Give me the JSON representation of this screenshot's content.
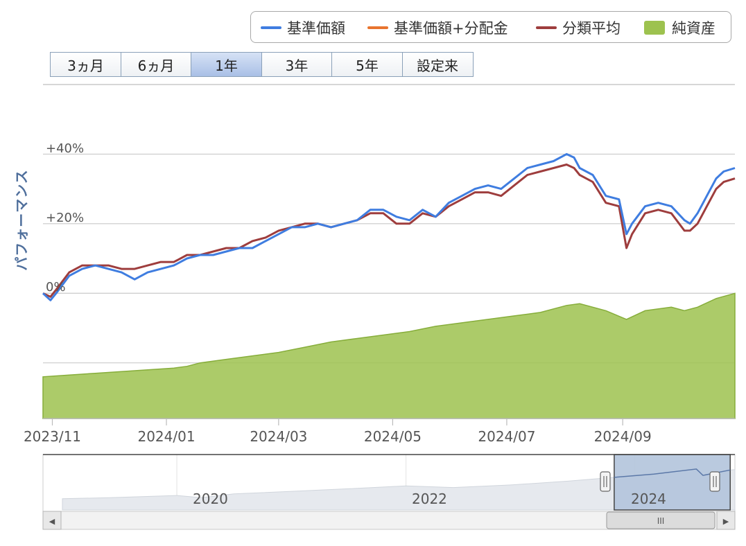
{
  "legend": {
    "items": [
      {
        "label": "基準価額",
        "color": "#3f7de0",
        "kind": "line"
      },
      {
        "label": "基準価額+分配金",
        "color": "#e8742e",
        "kind": "line"
      },
      {
        "label": "分類平均",
        "color": "#9e3d3d",
        "kind": "line"
      },
      {
        "label": "純資産",
        "color": "#9dc24f",
        "kind": "area"
      }
    ]
  },
  "range_buttons": [
    {
      "label": "3ヵ月",
      "selected": false
    },
    {
      "label": "6ヵ月",
      "selected": false
    },
    {
      "label": "1年",
      "selected": true
    },
    {
      "label": "3年",
      "selected": false
    },
    {
      "label": "5年",
      "selected": false
    },
    {
      "label": "設定来",
      "selected": false
    }
  ],
  "navigator": {
    "year_labels": [
      "2020",
      "2022",
      "2024"
    ],
    "scroll_grip": "III",
    "left_arrow": "◀",
    "right_arrow": "▶"
  },
  "chart_data": {
    "type": "line",
    "ylabel": "パフォーマンス",
    "y_ticks": [
      "+40%",
      "+20%",
      "0%"
    ],
    "ylim": [
      -36,
      60
    ],
    "x_ticks": [
      "2023/11",
      "2024/01",
      "2024/03",
      "2024/05",
      "2024/07",
      "2024/09"
    ],
    "x_range": [
      "2023-10-27",
      "2024-10-31"
    ],
    "grid": true,
    "legend_position": "top-right",
    "series": [
      {
        "name": "基準価額",
        "color": "#3f7de0",
        "points": [
          [
            "2023-10-27",
            0
          ],
          [
            "2023-10-31",
            -2
          ],
          [
            "2023-11-03",
            0
          ],
          [
            "2023-11-10",
            5
          ],
          [
            "2023-11-17",
            7
          ],
          [
            "2023-11-24",
            8
          ],
          [
            "2023-12-01",
            7
          ],
          [
            "2023-12-08",
            6
          ],
          [
            "2023-12-15",
            4
          ],
          [
            "2023-12-22",
            6
          ],
          [
            "2023-12-29",
            7
          ],
          [
            "2024-01-05",
            8
          ],
          [
            "2024-01-12",
            10
          ],
          [
            "2024-01-19",
            11
          ],
          [
            "2024-01-26",
            11
          ],
          [
            "2024-02-02",
            12
          ],
          [
            "2024-02-09",
            13
          ],
          [
            "2024-02-16",
            13
          ],
          [
            "2024-02-23",
            15
          ],
          [
            "2024-03-01",
            17
          ],
          [
            "2024-03-08",
            19
          ],
          [
            "2024-03-15",
            19
          ],
          [
            "2024-03-22",
            20
          ],
          [
            "2024-03-29",
            19
          ],
          [
            "2024-04-05",
            20
          ],
          [
            "2024-04-12",
            21
          ],
          [
            "2024-04-19",
            24
          ],
          [
            "2024-04-26",
            24
          ],
          [
            "2024-05-03",
            22
          ],
          [
            "2024-05-10",
            21
          ],
          [
            "2024-05-17",
            24
          ],
          [
            "2024-05-24",
            22
          ],
          [
            "2024-05-31",
            26
          ],
          [
            "2024-06-07",
            28
          ],
          [
            "2024-06-14",
            30
          ],
          [
            "2024-06-21",
            31
          ],
          [
            "2024-06-28",
            30
          ],
          [
            "2024-07-05",
            33
          ],
          [
            "2024-07-12",
            36
          ],
          [
            "2024-07-19",
            37
          ],
          [
            "2024-07-26",
            38
          ],
          [
            "2024-08-02",
            40
          ],
          [
            "2024-08-06",
            39
          ],
          [
            "2024-08-09",
            36
          ],
          [
            "2024-08-16",
            34
          ],
          [
            "2024-08-23",
            28
          ],
          [
            "2024-08-30",
            27
          ],
          [
            "2024-09-03",
            17
          ],
          [
            "2024-09-06",
            20
          ],
          [
            "2024-09-13",
            25
          ],
          [
            "2024-09-20",
            26
          ],
          [
            "2024-09-27",
            25
          ],
          [
            "2024-10-04",
            21
          ],
          [
            "2024-10-07",
            20
          ],
          [
            "2024-10-11",
            23
          ],
          [
            "2024-10-16",
            28
          ],
          [
            "2024-10-21",
            33
          ],
          [
            "2024-10-25",
            35
          ],
          [
            "2024-10-31",
            36
          ]
        ]
      },
      {
        "name": "分類平均",
        "color": "#9e3d3d",
        "points": [
          [
            "2023-10-27",
            0
          ],
          [
            "2023-10-31",
            -1
          ],
          [
            "2023-11-03",
            1
          ],
          [
            "2023-11-10",
            6
          ],
          [
            "2023-11-17",
            8
          ],
          [
            "2023-11-24",
            8
          ],
          [
            "2023-12-01",
            8
          ],
          [
            "2023-12-08",
            7
          ],
          [
            "2023-12-15",
            7
          ],
          [
            "2023-12-22",
            8
          ],
          [
            "2023-12-29",
            9
          ],
          [
            "2024-01-05",
            9
          ],
          [
            "2024-01-12",
            11
          ],
          [
            "2024-01-19",
            11
          ],
          [
            "2024-01-26",
            12
          ],
          [
            "2024-02-02",
            13
          ],
          [
            "2024-02-09",
            13
          ],
          [
            "2024-02-16",
            15
          ],
          [
            "2024-02-23",
            16
          ],
          [
            "2024-03-01",
            18
          ],
          [
            "2024-03-08",
            19
          ],
          [
            "2024-03-15",
            20
          ],
          [
            "2024-03-22",
            20
          ],
          [
            "2024-03-29",
            19
          ],
          [
            "2024-04-05",
            20
          ],
          [
            "2024-04-12",
            21
          ],
          [
            "2024-04-19",
            23
          ],
          [
            "2024-04-26",
            23
          ],
          [
            "2024-05-03",
            20
          ],
          [
            "2024-05-10",
            20
          ],
          [
            "2024-05-17",
            23
          ],
          [
            "2024-05-24",
            22
          ],
          [
            "2024-05-31",
            25
          ],
          [
            "2024-06-07",
            27
          ],
          [
            "2024-06-14",
            29
          ],
          [
            "2024-06-21",
            29
          ],
          [
            "2024-06-28",
            28
          ],
          [
            "2024-07-05",
            31
          ],
          [
            "2024-07-12",
            34
          ],
          [
            "2024-07-19",
            35
          ],
          [
            "2024-07-26",
            36
          ],
          [
            "2024-08-02",
            37
          ],
          [
            "2024-08-06",
            36
          ],
          [
            "2024-08-09",
            34
          ],
          [
            "2024-08-16",
            32
          ],
          [
            "2024-08-23",
            26
          ],
          [
            "2024-08-30",
            25
          ],
          [
            "2024-09-03",
            13
          ],
          [
            "2024-09-06",
            17
          ],
          [
            "2024-09-13",
            23
          ],
          [
            "2024-09-20",
            24
          ],
          [
            "2024-09-27",
            23
          ],
          [
            "2024-10-04",
            18
          ],
          [
            "2024-10-07",
            18
          ],
          [
            "2024-10-11",
            20
          ],
          [
            "2024-10-16",
            25
          ],
          [
            "2024-10-21",
            30
          ],
          [
            "2024-10-25",
            32
          ],
          [
            "2024-10-31",
            33
          ]
        ]
      },
      {
        "name": "純資産",
        "color": "#9dc24f",
        "kind": "area",
        "points": [
          [
            "2023-10-27",
            -24
          ],
          [
            "2023-11-10",
            -23.5
          ],
          [
            "2023-11-24",
            -23
          ],
          [
            "2023-12-08",
            -22.5
          ],
          [
            "2023-12-22",
            -22
          ],
          [
            "2024-01-05",
            -21.5
          ],
          [
            "2024-01-12",
            -21
          ],
          [
            "2024-01-19",
            -20
          ],
          [
            "2024-02-02",
            -19
          ],
          [
            "2024-02-16",
            -18
          ],
          [
            "2024-03-01",
            -17
          ],
          [
            "2024-03-15",
            -15.5
          ],
          [
            "2024-03-29",
            -14
          ],
          [
            "2024-04-12",
            -13
          ],
          [
            "2024-04-26",
            -12
          ],
          [
            "2024-05-10",
            -11
          ],
          [
            "2024-05-24",
            -9.5
          ],
          [
            "2024-06-07",
            -8.5
          ],
          [
            "2024-06-21",
            -7.5
          ],
          [
            "2024-07-05",
            -6.5
          ],
          [
            "2024-07-19",
            -5.5
          ],
          [
            "2024-08-02",
            -3.5
          ],
          [
            "2024-08-09",
            -3
          ],
          [
            "2024-08-23",
            -5
          ],
          [
            "2024-09-03",
            -7.5
          ],
          [
            "2024-09-13",
            -5
          ],
          [
            "2024-09-27",
            -4
          ],
          [
            "2024-10-04",
            -5
          ],
          [
            "2024-10-11",
            -4
          ],
          [
            "2024-10-21",
            -1.5
          ],
          [
            "2024-10-31",
            0
          ]
        ]
      }
    ]
  },
  "navigator_data": {
    "x_range": [
      "2019-01-01",
      "2024-11-15"
    ],
    "selection": [
      "2023-10-27",
      "2024-10-31"
    ],
    "points": [
      [
        "2019-01-01",
        0.05
      ],
      [
        "2019-06-01",
        0.08
      ],
      [
        "2020-01-01",
        0.15
      ],
      [
        "2020-03-20",
        0.08
      ],
      [
        "2020-07-01",
        0.2
      ],
      [
        "2021-01-01",
        0.28
      ],
      [
        "2021-07-01",
        0.36
      ],
      [
        "2022-01-01",
        0.45
      ],
      [
        "2022-06-01",
        0.4
      ],
      [
        "2022-12-01",
        0.48
      ],
      [
        "2023-06-01",
        0.6
      ],
      [
        "2023-10-27",
        0.72
      ],
      [
        "2024-03-01",
        0.82
      ],
      [
        "2024-07-15",
        0.98
      ],
      [
        "2024-08-05",
        0.78
      ],
      [
        "2024-10-31",
        0.95
      ],
      [
        "2024-11-15",
        0.96
      ]
    ]
  }
}
